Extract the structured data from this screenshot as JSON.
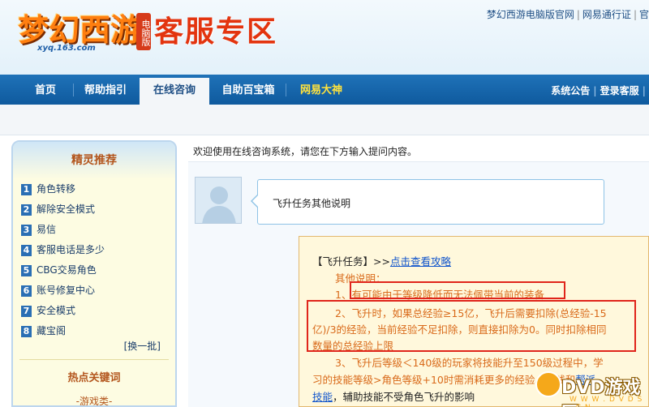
{
  "header": {
    "logo_title": "梦幻西游",
    "logo_badge": "电脑版",
    "logo_sub": "xyq.163.com",
    "zone_title": "客服专区",
    "top_links": [
      "梦幻西游电脑版官网",
      "网易通行证",
      "官"
    ]
  },
  "nav": {
    "items": [
      "首页",
      "帮助指引",
      "在线咨询",
      "自助百宝箱",
      "网易大神"
    ],
    "right": [
      "系统公告",
      "登录客服"
    ]
  },
  "sidebar": {
    "title": "精灵推荐",
    "items": [
      {
        "num": "1",
        "label": "角色转移"
      },
      {
        "num": "2",
        "label": "解除安全模式"
      },
      {
        "num": "3",
        "label": "易信"
      },
      {
        "num": "4",
        "label": "客服电话是多少"
      },
      {
        "num": "5",
        "label": "CBG交易角色"
      },
      {
        "num": "6",
        "label": "账号修复中心"
      },
      {
        "num": "7",
        "label": "安全模式"
      },
      {
        "num": "8",
        "label": "藏宝阁"
      }
    ],
    "more": "[换一批]",
    "hot_title": "热点关键词",
    "hot_sub": "-游戏类-"
  },
  "main": {
    "welcome": "欢迎使用在线咨询系统，请您在下方输入提问内容。",
    "question": "飞升任务其他说明",
    "answer": {
      "line1_prefix": "【飞升任务】>>",
      "line1_link": "点击查看攻略",
      "line2": "其他说明：",
      "line3": "1、有可能由于等级降低而无法佩带当前的装备",
      "line4": "2、飞升时，如果总经验≥15亿，飞升后需要扣除(总经验-15",
      "line5": "亿)/3的经验，当前经验不足扣除，则直接扣除为0。同时扣除相同",
      "line6": "数量的总经验上限",
      "line7": "3、飞升后等级＜140级的玩家将技能升至150级过程中，学",
      "line8": "习的技能等级>角色等级+10时需消耗更多的经验、金钱和",
      "line8_link": "帮派",
      "line9_link": "技能",
      "line9": "，辅助技能不受角色飞升的影响"
    }
  },
  "watermark": {
    "text": "DVD游戏网",
    "url": "W W W . D V D S . C N"
  }
}
